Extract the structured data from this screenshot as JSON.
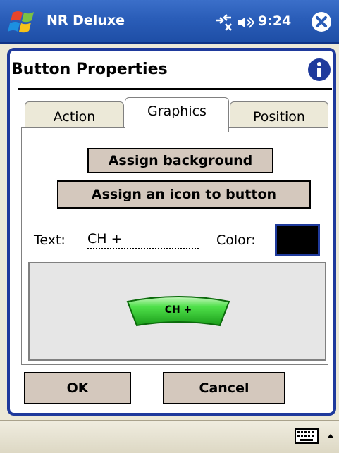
{
  "titlebar": {
    "app_name": "NR Deluxe",
    "time": "9:24",
    "icons": [
      "windows-start-icon",
      "connectivity-icon",
      "volume-icon",
      "close-icon"
    ]
  },
  "dialog": {
    "title": "Button Properties",
    "info_icon": "info-icon"
  },
  "tabs": [
    {
      "label": "Action",
      "active": false
    },
    {
      "label": "Graphics",
      "active": true
    },
    {
      "label": "Position",
      "active": false
    }
  ],
  "graphics": {
    "assign_background_label": "Assign background",
    "assign_icon_label": "Assign an icon to button",
    "text_label": "Text:",
    "text_value": "CH +",
    "color_label": "Color:",
    "color_value": "#000000",
    "preview_button_label": "CH +"
  },
  "actions": {
    "ok_label": "OK",
    "cancel_label": "Cancel"
  },
  "colors": {
    "titlebar": "#2a5db8",
    "frame_border": "#1f3a9c",
    "button_bg": "#d4c8bd",
    "preview_green": "#2fcf2f"
  }
}
